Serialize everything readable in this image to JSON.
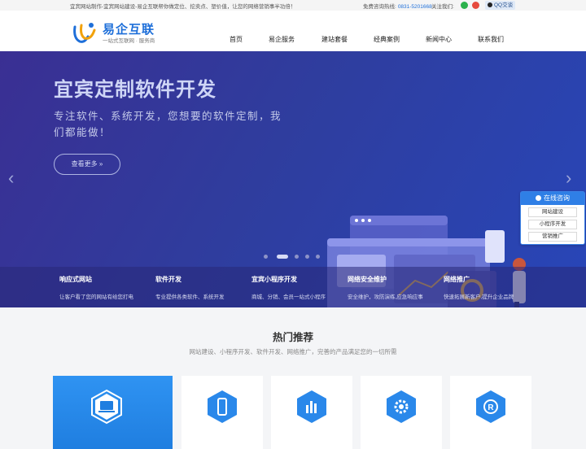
{
  "topbar": {
    "tagline": "宜宾网站制作-宜宾网站建设-易企互联帮你做定位、挖卖点、塑价值，让您的网络营销事半功倍！",
    "hotline_label": "免费咨询热线:",
    "hotline_number": "0831-5201668",
    "follow_label": "关注我们:",
    "qq_label": "QQ交谈"
  },
  "brand": {
    "name": "易企互联",
    "slogan": "一站式互联网 · 服务商",
    "color": "#1e6fd9"
  },
  "nav": [
    "首页",
    "易企服务",
    "建站套餐",
    "经典案例",
    "新闻中心",
    "联系我们"
  ],
  "hero": {
    "title": "宜宾定制软件开发",
    "subtitle": "专注软件、系统开发，您想要的软件定制，我们都能做！",
    "more_label": "查看更多 »",
    "prev_icon": "chevron-left-icon",
    "next_icon": "chevron-right-icon",
    "slide_count": 5,
    "active_slide": 1
  },
  "features": [
    {
      "title": "响应式网站",
      "desc": "让客户看了您的网站有给您打电"
    },
    {
      "title": "软件开发",
      "desc": "专业提供各类软件、系统开发"
    },
    {
      "title": "宜宾小程序开发",
      "desc": "商城、分销、会员一站式小程序"
    },
    {
      "title": "网络安全维护",
      "desc": "安全维护，攻防演练,应急响应事"
    },
    {
      "title": "网络推广",
      "desc": "快速拓展新客户,提升企业品牌"
    }
  ],
  "consult": {
    "title": "在线咨询",
    "items": [
      "网站建设",
      "小程序开发",
      "营销推广"
    ]
  },
  "hot": {
    "title": "热门推荐",
    "subtitle": "网站建设、小程序开发、软件开发、网络推广，完善的产品满足您的一切所需",
    "cards": [
      {
        "icon": "laptop-icon",
        "active": true
      },
      {
        "icon": "mobile-icon",
        "active": false
      },
      {
        "icon": "bar-chart-icon",
        "active": false
      },
      {
        "icon": "gear-icon",
        "active": false
      },
      {
        "icon": "registered-icon",
        "active": false
      }
    ]
  }
}
